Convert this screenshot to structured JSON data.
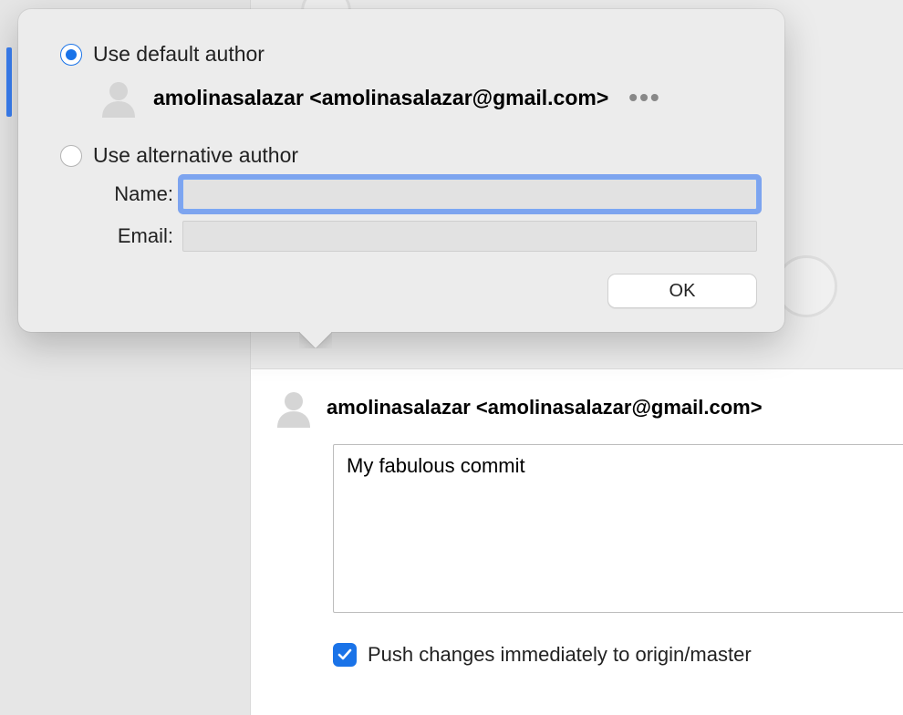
{
  "popover": {
    "default_radio_label": "Use default author",
    "default_radio_selected": true,
    "default_author_display": "amolinasalazar <amolinasalazar@gmail.com>",
    "alt_radio_label": "Use alternative author",
    "alt_radio_selected": false,
    "fields": {
      "name_label": "Name:",
      "name_value": "",
      "email_label": "Email:",
      "email_value": ""
    },
    "ok_label": "OK"
  },
  "commit": {
    "author_display": "amolinasalazar <amolinasalazar@gmail.com>",
    "message": "My fabulous commit",
    "push_checked": true,
    "push_label": "Push changes immediately to origin/master"
  }
}
